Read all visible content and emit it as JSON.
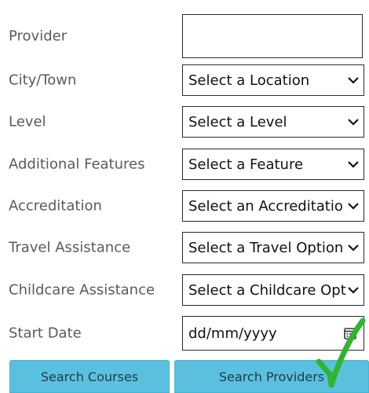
{
  "form": {
    "provider": {
      "label": "Provider",
      "value": ""
    },
    "city": {
      "label": "City/Town",
      "value": "Select a Location"
    },
    "level": {
      "label": "Level",
      "value": "Select a Level"
    },
    "features": {
      "label": "Additional Features",
      "value": "Select a Feature"
    },
    "accreditation": {
      "label": "Accreditation",
      "value": "Select an Accreditatio"
    },
    "travel": {
      "label": "Travel Assistance",
      "value": "Select a Travel Option"
    },
    "childcare": {
      "label": "Childcare Assistance",
      "value": "Select a Childcare Opt"
    },
    "start_date": {
      "label": "Start Date",
      "placeholder": "dd/mm/yyyy"
    }
  },
  "buttons": {
    "search_courses": "Search Courses",
    "search_providers": "Search Providers"
  },
  "icons": {
    "dropdown": "chevron-down-icon",
    "calendar": "calendar-icon",
    "annotation": "green-checkmark-icon"
  },
  "colors": {
    "button_bg": "#5bc0de",
    "button_text": "#1f3b4a",
    "label_text": "#5a5a5a",
    "checkmark": "#2fb52f"
  }
}
